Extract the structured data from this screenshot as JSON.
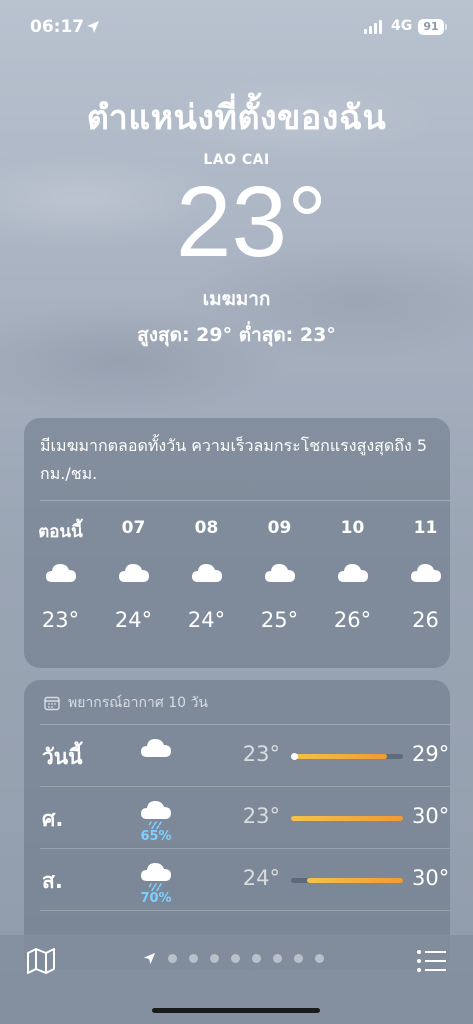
{
  "status_bar": {
    "time": "06:17",
    "network": "4G",
    "battery": "91"
  },
  "header": {
    "location_title": "ตำแหน่งที่ตั้งของฉัน",
    "city": "LAO CAI",
    "temperature": "23°",
    "condition": "เมฆมาก",
    "high_low": "สูงสุด: 29°  ต่ำสุด: 23°"
  },
  "hourly": {
    "summary": "มีเมฆมากตลอดทั้งวัน ความเร็วลมกระโชกแรงสูงสุดถึง 5 กม./ชม.",
    "items": [
      {
        "label": "ตอนนี้",
        "temp": "23°",
        "icon": "cloud-icon"
      },
      {
        "label": "07",
        "temp": "24°",
        "icon": "cloud-icon"
      },
      {
        "label": "08",
        "temp": "24°",
        "icon": "cloud-icon"
      },
      {
        "label": "09",
        "temp": "25°",
        "icon": "cloud-icon"
      },
      {
        "label": "10",
        "temp": "26°",
        "icon": "cloud-icon"
      },
      {
        "label": "11",
        "temp": "26",
        "icon": "cloud-icon"
      }
    ]
  },
  "daily": {
    "title": "พยากรณ์อากาศ 10 วัน",
    "range_min": 23,
    "range_max": 30,
    "rows": [
      {
        "day": "วันนี้",
        "icon": "cloud-icon",
        "pop": "",
        "low": "23°",
        "high": "29°",
        "low_val": 23,
        "high_val": 29,
        "current": true
      },
      {
        "day": "ศ.",
        "icon": "cloud-rain-icon",
        "pop": "65%",
        "low": "23°",
        "high": "30°",
        "low_val": 23,
        "high_val": 30,
        "current": false
      },
      {
        "day": "ส.",
        "icon": "cloud-rain-icon",
        "pop": "70%",
        "low": "24°",
        "high": "30°",
        "low_val": 24,
        "high_val": 30,
        "current": false
      }
    ]
  },
  "colors": {
    "accent_temp_bar": "#f29a33",
    "precip": "#7fcfff"
  },
  "toolbar": {
    "page_count": 8
  }
}
